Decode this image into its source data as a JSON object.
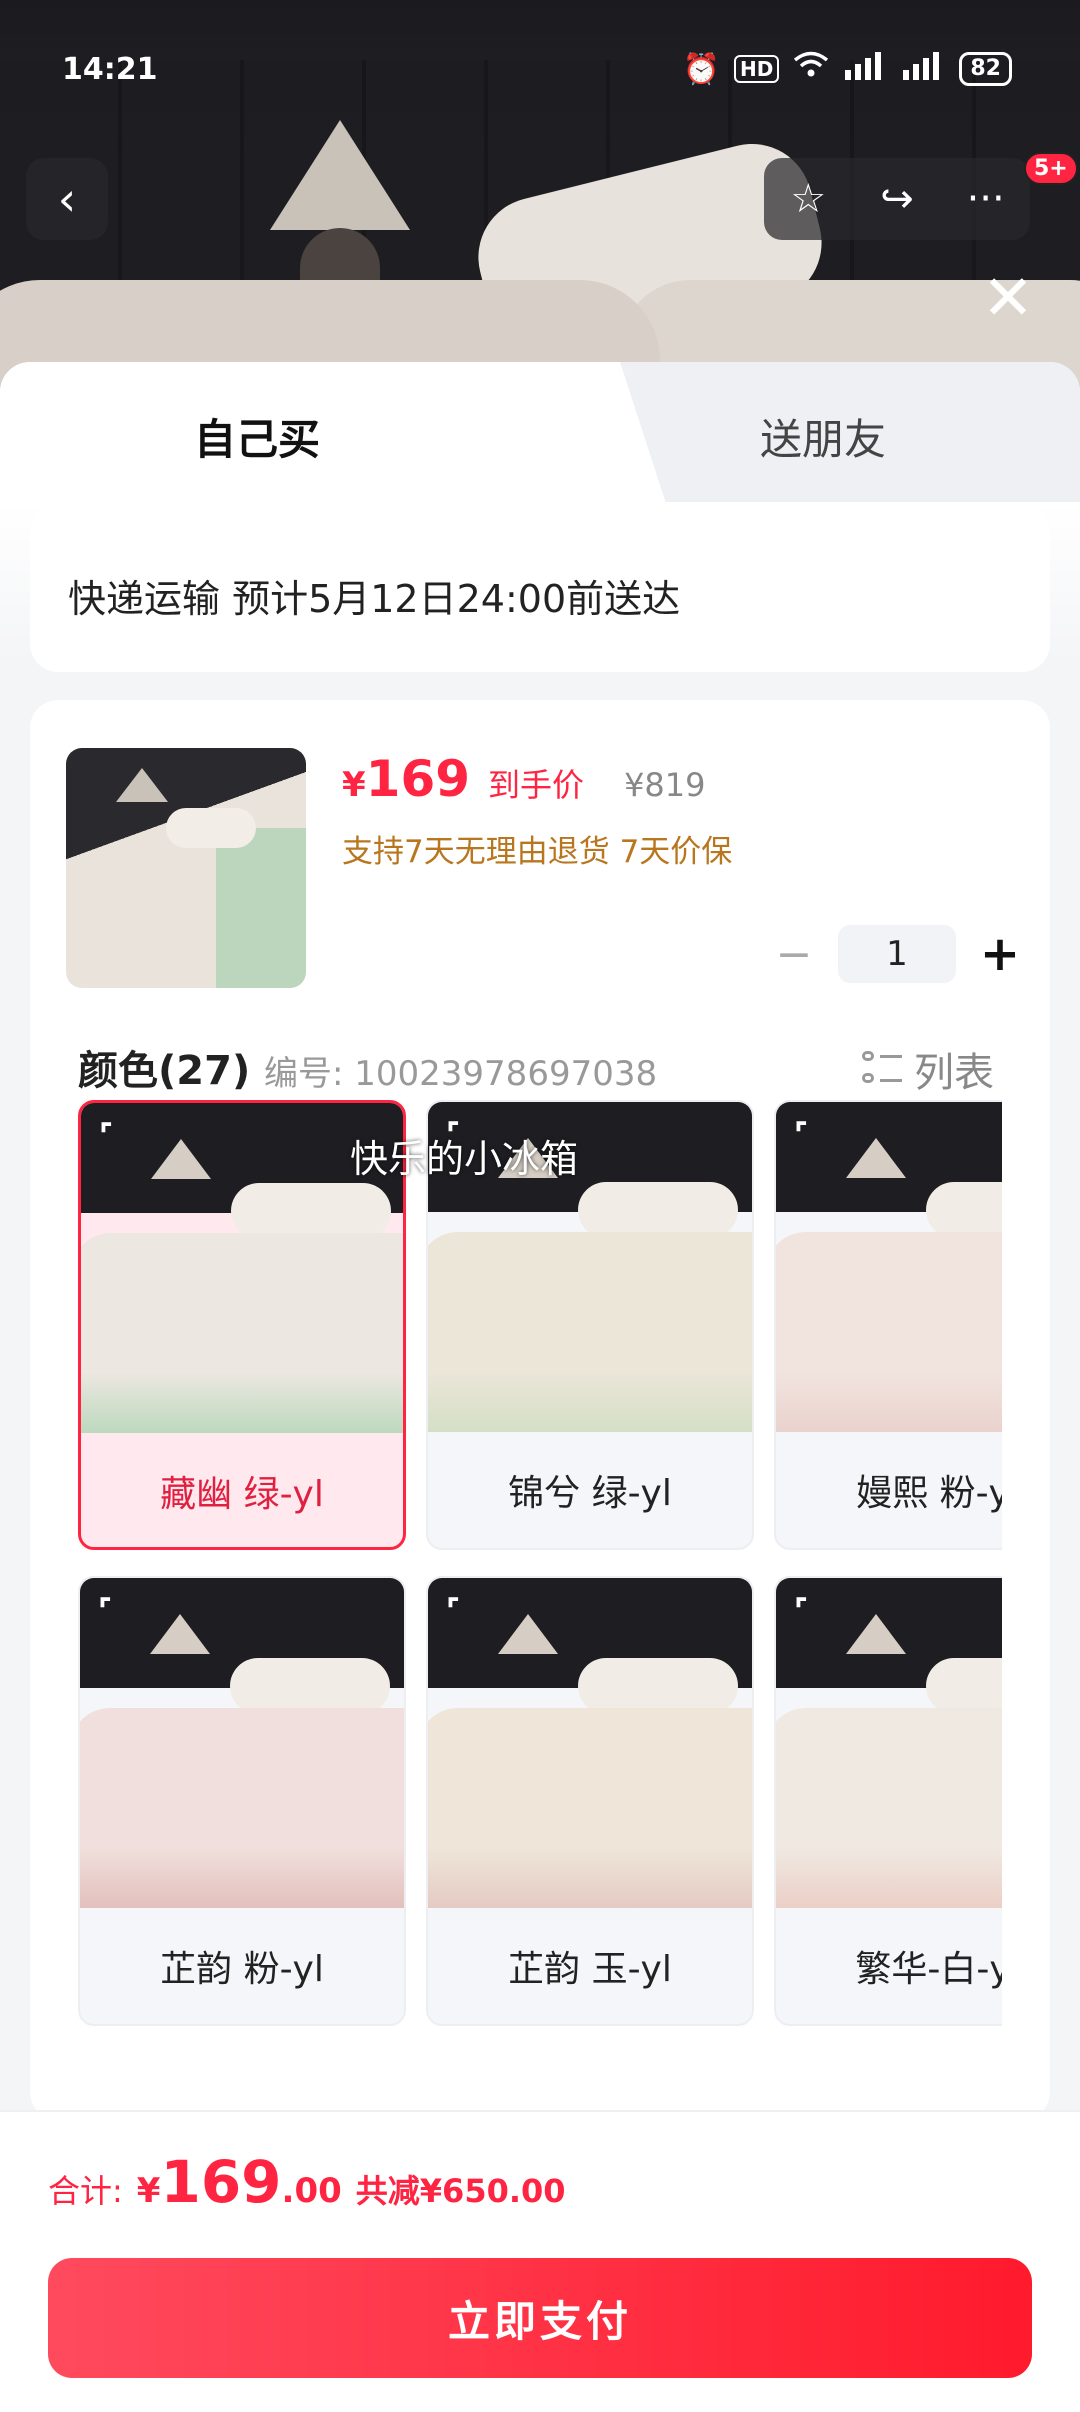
{
  "status_bar": {
    "time": "14:21",
    "hd": "HD",
    "signal1": "5G",
    "signal2": "5G",
    "battery": "82"
  },
  "nav": {
    "back_glyph": "‹",
    "favorite_glyph": "☆",
    "share_glyph": "↪",
    "more_glyph": "···",
    "badge": "5+",
    "close_glyph": "✕"
  },
  "tabs": {
    "self": "自己买",
    "gift": "送朋友"
  },
  "shipping": {
    "text": "快递运输 预计5月12日24:00前送达"
  },
  "product": {
    "price_symbol": "¥",
    "price": "169",
    "price_tag": "到手价",
    "original_price": "¥819",
    "service": "支持7天无理由退货 7天价保",
    "quantity": "1",
    "minus": "−",
    "plus": "+"
  },
  "color_section": {
    "title": "颜色(27)",
    "sku": "编号: 10023978697038",
    "list_label": "列表",
    "watermark": "快乐的小冰箱",
    "options": [
      {
        "label": "藏幽 绿-yl",
        "selected": true,
        "duvet": "#ece7e0",
        "sheet": "#bdd9be"
      },
      {
        "label": "锦兮 绿-yl",
        "selected": false,
        "duvet": "#ebe6d8",
        "sheet": "#d4dfc6"
      },
      {
        "label": "嫚熙 粉-yl",
        "selected": false,
        "duvet": "#f1e4df",
        "sheet": "#ead2cd"
      },
      {
        "label": "芷韵 粉-yl",
        "selected": false,
        "duvet": "#f0dfdc",
        "sheet": "#e2c0bd"
      },
      {
        "label": "芷韵 玉-yl",
        "selected": false,
        "duvet": "#efe5d9",
        "sheet": "#e4cbc4"
      },
      {
        "label": "繁华-白-yl",
        "selected": false,
        "duvet": "#efe9e2",
        "sheet": "#ebcfc6"
      }
    ]
  },
  "bottom": {
    "total_label": "合计:",
    "total_yen": "¥",
    "total_int": "169",
    "total_dec": ".00",
    "total_save": "共减¥650.00",
    "pay_label": "立即支付"
  },
  "colors": {
    "accent": "#ff2442",
    "service": "#b8761e"
  }
}
